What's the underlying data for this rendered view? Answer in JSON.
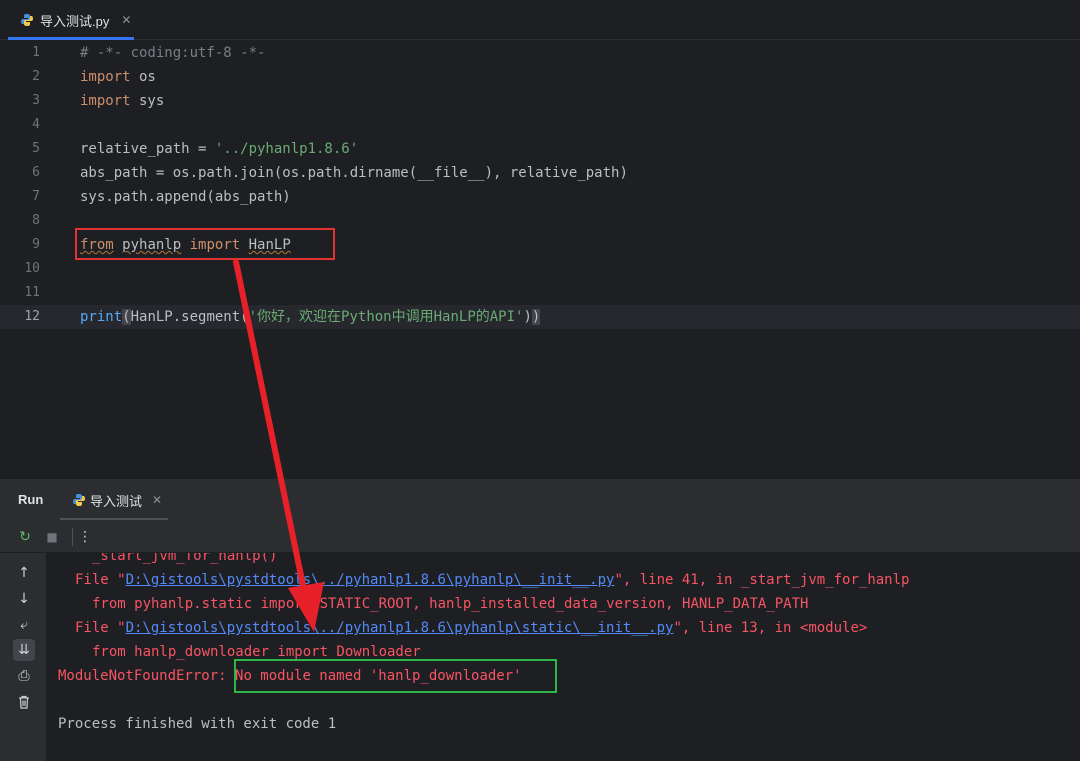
{
  "editor_tab": {
    "filename": "导入测试.py",
    "close": "✕"
  },
  "code_lines": [
    {
      "num": "1",
      "tokens": [
        {
          "t": "# -*- coding:utf-8 -*-",
          "c": "cmt"
        }
      ]
    },
    {
      "num": "2",
      "tokens": [
        {
          "t": "import",
          "c": "kw"
        },
        {
          "t": " os",
          "c": ""
        }
      ]
    },
    {
      "num": "3",
      "tokens": [
        {
          "t": "import",
          "c": "kw"
        },
        {
          "t": " sys",
          "c": ""
        }
      ]
    },
    {
      "num": "4",
      "tokens": []
    },
    {
      "num": "5",
      "tokens": [
        {
          "t": "relative_path = ",
          "c": ""
        },
        {
          "t": "'../pyhanlp1.8.6'",
          "c": "str"
        }
      ]
    },
    {
      "num": "6",
      "tokens": [
        {
          "t": "abs_path = os.path.join(os.path.dirname(__file__), relative_path)",
          "c": ""
        }
      ]
    },
    {
      "num": "7",
      "tokens": [
        {
          "t": "sys.path.append(abs_path)",
          "c": ""
        }
      ]
    },
    {
      "num": "8",
      "tokens": []
    },
    {
      "num": "9",
      "tokens": [
        {
          "t": "from",
          "c": "kw squiggle"
        },
        {
          "t": " ",
          "c": ""
        },
        {
          "t": "pyhanlp",
          "c": "squiggle"
        },
        {
          "t": " ",
          "c": ""
        },
        {
          "t": "import",
          "c": "kw"
        },
        {
          "t": " ",
          "c": ""
        },
        {
          "t": "HanLP",
          "c": "squiggle"
        }
      ]
    },
    {
      "num": "10",
      "tokens": []
    },
    {
      "num": "11",
      "tokens": []
    },
    {
      "num": "12",
      "tokens": [
        {
          "t": "print",
          "c": "fn"
        },
        {
          "t": "(",
          "c": "paren"
        },
        {
          "t": "HanLP.segment(",
          "c": ""
        },
        {
          "t": "'你好，欢迎在Python中调用HanLP的API'",
          "c": "str"
        },
        {
          "t": ")",
          "c": ""
        },
        {
          "t": ")",
          "c": "paren"
        }
      ]
    }
  ],
  "run_window": {
    "title": "Run",
    "tab_label": "导入测试",
    "close": "✕"
  },
  "console_lines": [
    [
      {
        "t": "  _start_jvm_for_hanlp()",
        "c": "err"
      }
    ],
    [
      {
        "t": "File \"",
        "c": "err"
      },
      {
        "t": "D:\\gistools\\pystdtools\\../pyhanlp1.8.6\\pyhanlp\\__init__.py",
        "c": "link"
      },
      {
        "t": "\", line 41, in _start_jvm_for_hanlp",
        "c": "err"
      }
    ],
    [
      {
        "t": "  from pyhanlp.static import STATIC_ROOT, hanlp_installed_data_version, HANLP_DATA_PATH",
        "c": "err"
      }
    ],
    [
      {
        "t": "File \"",
        "c": "err"
      },
      {
        "t": "D:\\gistools\\pystdtools\\../pyhanlp1.8.6\\pyhanlp\\static\\__init__.py",
        "c": "link"
      },
      {
        "t": "\", line 13, in <module>",
        "c": "err"
      }
    ],
    [
      {
        "t": "  from hanlp_downloader import Downloader",
        "c": "err"
      }
    ],
    [
      {
        "t": "ModuleNotFoundError: ",
        "c": "err"
      },
      {
        "t": "No module named 'hanlp_downloader'",
        "c": "err"
      }
    ],
    [],
    [
      {
        "t": "Process finished with exit code 1",
        "c": "normal"
      }
    ]
  ],
  "colors": {
    "accent": "#3574f0",
    "error": "#f75464",
    "annotation_red": "#e03434",
    "annotation_green": "#2fb648"
  },
  "icons": {
    "rerun": "↻",
    "stop": "■",
    "more": "⋮",
    "up": "↑",
    "down": "↓",
    "soft_wrap": "⤶",
    "scroll_end": "⇊",
    "print": "⎙",
    "trash": "🗑"
  }
}
